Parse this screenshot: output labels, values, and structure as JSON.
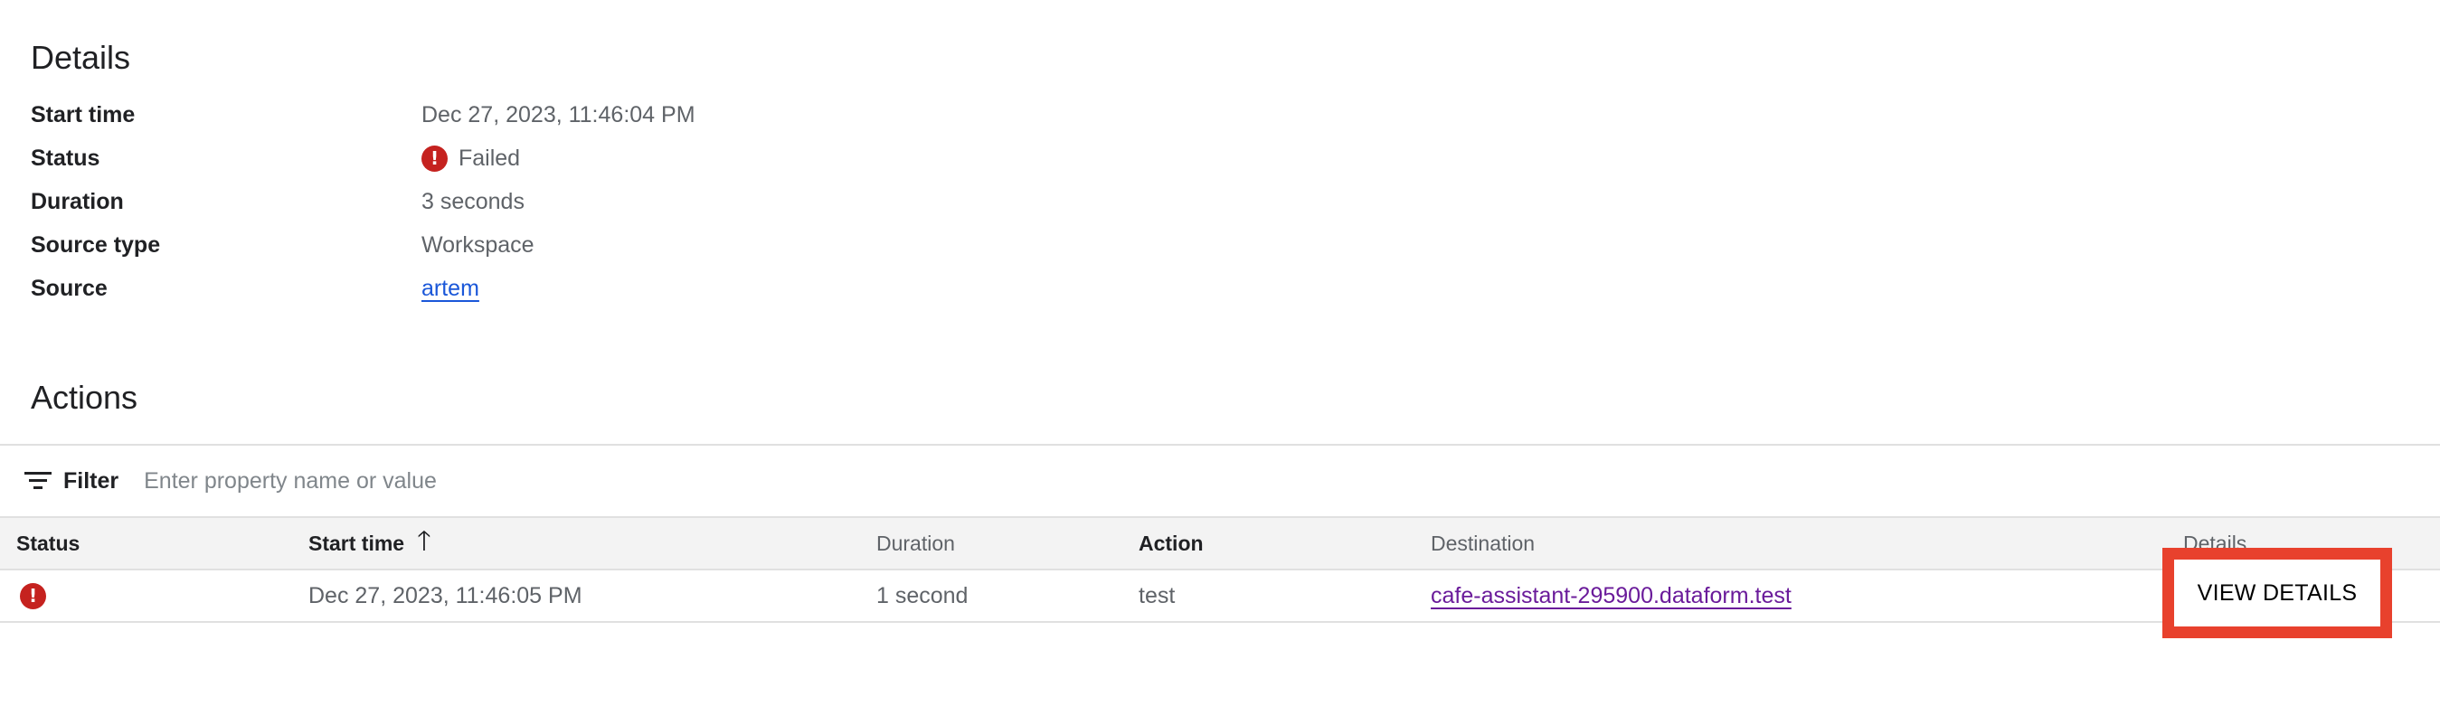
{
  "details": {
    "title": "Details",
    "rows": [
      {
        "label": "Start time",
        "value": "Dec 27, 2023, 11:46:04 PM"
      },
      {
        "label": "Status",
        "value": "Failed",
        "icon": "error-icon"
      },
      {
        "label": "Duration",
        "value": "3 seconds"
      },
      {
        "label": "Source type",
        "value": "Workspace"
      },
      {
        "label": "Source",
        "value": "artem",
        "link": true
      }
    ]
  },
  "actions": {
    "title": "Actions",
    "filter": {
      "label": "Filter",
      "placeholder": "Enter property name or value",
      "icon": "filter-icon"
    },
    "columns": {
      "status": "Status",
      "start_time": "Start time",
      "duration": "Duration",
      "action": "Action",
      "destination": "Destination",
      "details": "Details"
    },
    "rows": [
      {
        "status_icon": "error-icon",
        "start_time": "Dec 27, 2023, 11:46:05 PM",
        "duration": "1 second",
        "action": "test",
        "destination": "cafe-assistant-295900.dataform.test",
        "details_button": "VIEW DETAILS"
      }
    ]
  },
  "colors": {
    "error": "#c5221f",
    "link": "#1a57d9",
    "visited_link": "#6a1b9a",
    "highlight": "#e8412d"
  }
}
